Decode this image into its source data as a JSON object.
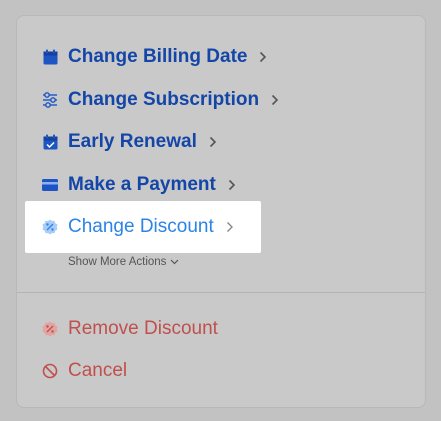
{
  "actions": {
    "items": [
      {
        "label": "Change Billing Date",
        "icon": "calendar-icon"
      },
      {
        "label": "Change Subscription",
        "icon": "sliders-icon"
      },
      {
        "label": "Early Renewal",
        "icon": "calendar-check-icon"
      },
      {
        "label": "Make a Payment",
        "icon": "credit-card-icon"
      },
      {
        "label": "Change Discount",
        "icon": "discount-badge-icon"
      }
    ],
    "show_more_label": "Show More Actions",
    "danger_items": [
      {
        "label": "Remove Discount",
        "icon": "discount-badge-icon"
      },
      {
        "label": "Cancel",
        "icon": "cancel-icon"
      }
    ]
  },
  "colors": {
    "primary": "#1446a8",
    "highlight_text": "#2b84e6",
    "danger": "#c0504d"
  }
}
